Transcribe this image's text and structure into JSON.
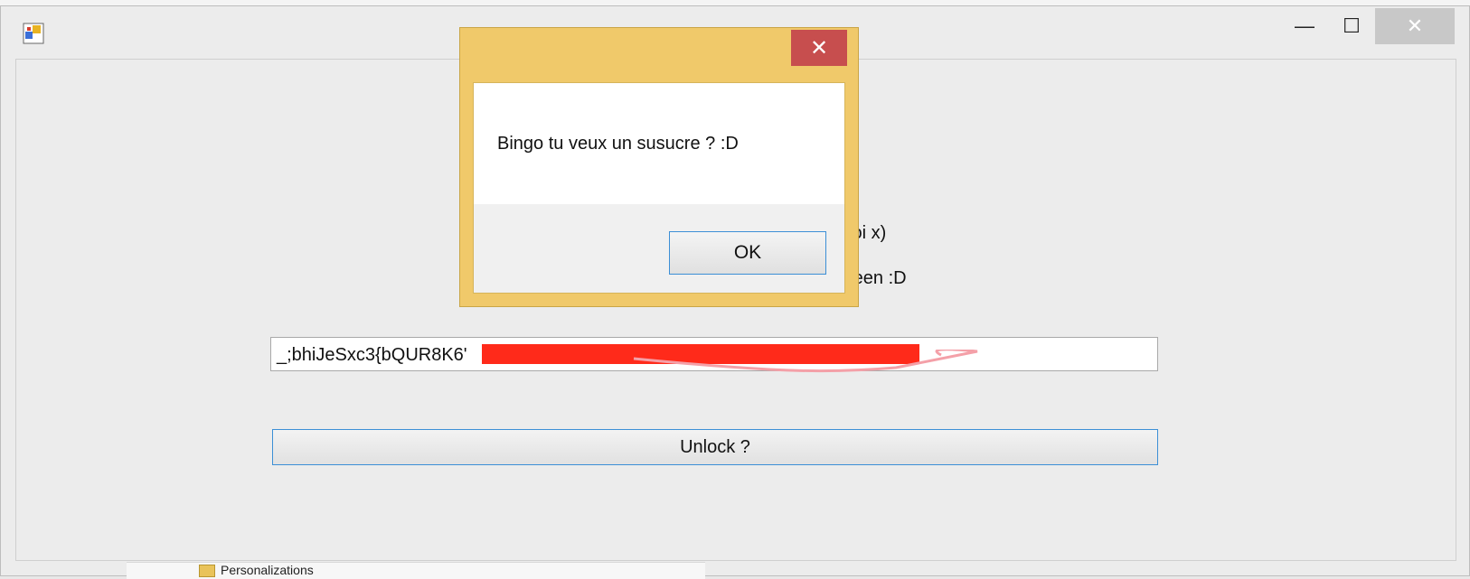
{
  "main_window": {
    "title": "",
    "controls": {
      "minimize": "—",
      "maximize": "☐",
      "close": "✕"
    },
    "labels": {
      "partial_line1": "toi x)",
      "partial_line2": "reen :D"
    },
    "password_field": {
      "value": "_;bhiJeSxc3{bQUR8K6'"
    },
    "unlock_button": "Unlock ?"
  },
  "dialog": {
    "close": "✕",
    "message": "Bingo tu veux un susucre ? :D",
    "ok_button": "OK"
  },
  "background": {
    "explorer_bottom_text": "Personalizations"
  },
  "colors": {
    "dialog_frame": "#f0c96a",
    "dialog_close": "#c74e4e",
    "focus_border": "#3c8fd6",
    "redaction": "#ff2a1a"
  }
}
